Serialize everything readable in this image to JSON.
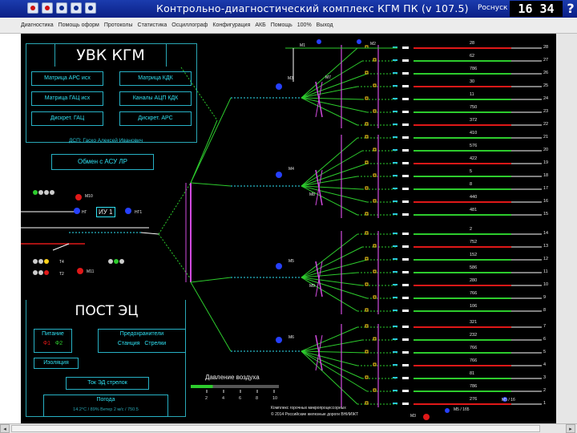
{
  "window": {
    "title": "Контрольно-диагностический комплекс КГМ ПК (v 107.5)",
    "user": "Роснуск",
    "clock": "16 34",
    "help": "?"
  },
  "menu": [
    "Диагностика",
    "Помощь оформ",
    "Протоколы",
    "Статистика",
    "Осциллограф",
    "Конфигурация",
    "АКБ",
    "Помощь",
    "100%",
    "Выход"
  ],
  "uvk": {
    "title": "УВК КГМ",
    "buttons": [
      "Матрица АРС исх",
      "Матрица КДК",
      "Матрица ГАЦ исх",
      "Каналы АЦП КДК",
      "Дискрет. ГАЦ",
      "Дискрет. АРС"
    ],
    "operator": "ДСП: Гаско Алексей Иванович",
    "exchange": "Обмен с АСУ ЛР"
  },
  "post": {
    "title": "ПОСТ ЭЦ",
    "power": "Питание",
    "power_f1": "Ф1",
    "power_f2": "Ф2",
    "insulation": "Изоляция",
    "fuses": "Предохранители",
    "fuse_station": "Станция",
    "fuse_switches": "Стрелки",
    "switch_current": "Ток ЭД стрелок",
    "weather": "Погода",
    "weather_values": "14.2°С / 89% Ветер 2 м/с / 750.5"
  },
  "pressure": {
    "title": "Давление воздуха",
    "ticks": [
      "2",
      "4",
      "6",
      "8",
      "10"
    ],
    "level": 0.25
  },
  "footer": {
    "line1": "Комплекс горочных микропроцессорных",
    "line2": "© 2014 Российские железные дороги ВНИИЖТ"
  },
  "signals": {
    "left": [
      "М10",
      "НГ",
      "НГ1",
      "М11",
      "ИУ 1",
      "Т4",
      "Т2"
    ],
    "top": [
      "М1",
      "М2",
      "М3",
      "М4",
      "М5",
      "М6",
      "М7",
      "М8",
      "М9"
    ],
    "bottom": [
      "М3",
      "М5 / 1б5",
      "М5 / 1б"
    ]
  },
  "track_values": {
    "group1": [
      "28",
      "62",
      "786",
      "30",
      "11",
      "750",
      "372"
    ],
    "group2": [
      "410",
      "576",
      "422",
      "5",
      "8",
      "440",
      "481"
    ],
    "group3": [
      "2",
      "752",
      "152",
      "586",
      "280",
      "766",
      "106"
    ],
    "group4": [
      "321",
      "232",
      "766",
      "766",
      "81",
      "786",
      "276"
    ]
  },
  "track_numbers": {
    "group1": [
      "28",
      "27",
      "26",
      "25",
      "24",
      "23",
      "22"
    ],
    "group2": [
      "21",
      "20",
      "19",
      "18",
      "17",
      "16",
      "15"
    ],
    "group3": [
      "14",
      "13",
      "12",
      "11",
      "10",
      "9",
      "8"
    ],
    "group4": [
      "7",
      "6",
      "5",
      "4",
      "3",
      "2",
      "1"
    ]
  },
  "colors": {
    "panel_border": "#29a7b5",
    "button_text": "#2fe2f4",
    "track_green": "#2dcc2d",
    "track_red": "#e01818",
    "switch_white": "#ffffff",
    "switch_magenta": "#d24be0",
    "signal_blue": "#2640ff",
    "signal_red": "#e01818",
    "title_blue": "#0a1f86"
  }
}
